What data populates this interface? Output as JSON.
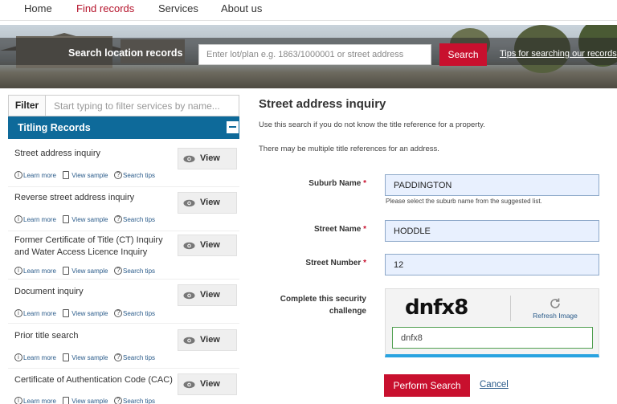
{
  "nav": {
    "items": [
      {
        "label": "Home",
        "active": false
      },
      {
        "label": "Find records",
        "active": true
      },
      {
        "label": "Services",
        "active": false
      },
      {
        "label": "About us",
        "active": false
      }
    ]
  },
  "banner": {
    "search_label": "Search location records",
    "search_placeholder": "Enter lot/plan e.g. 1863/1000001 or street address",
    "search_button": "Search",
    "tips_link": "Tips for searching our records"
  },
  "sidebar": {
    "filter_label": "Filter",
    "filter_placeholder": "Start typing to filter services by name...",
    "group_title": "Titling Records",
    "view_label": "View",
    "links": {
      "learn_more": "Learn more",
      "view_sample": "View sample",
      "search_tips": "Search tips"
    },
    "services": [
      {
        "title": "Street address inquiry"
      },
      {
        "title": "Reverse street address inquiry"
      },
      {
        "title": "Former Certificate of Title (CT) Inquiry and Water Access Licence Inquiry"
      },
      {
        "title": "Document inquiry"
      },
      {
        "title": "Prior title search"
      },
      {
        "title": "Certificate of Authentication Code (CAC)"
      }
    ]
  },
  "main": {
    "title": "Street address inquiry",
    "intro_1": "Use this search if you do not know the title reference for a property.",
    "intro_2": "There may be multiple title references for an address.",
    "required_marker": "*",
    "suburb": {
      "label": "Suburb Name",
      "value": "PADDINGTON",
      "hint": "Please select the suburb name from the suggested list."
    },
    "street": {
      "label": "Street Name",
      "value": "HODDLE"
    },
    "number": {
      "label": "Street Number",
      "value": "12"
    },
    "captcha": {
      "label_line1": "Complete this security",
      "label_line2": "challenge",
      "image_text": "dnfx8",
      "refresh_label": "Refresh Image",
      "input_value": "dnfx8"
    },
    "perform_button": "Perform Search",
    "cancel_link": "Cancel"
  },
  "colors": {
    "brand_red": "#c8102e",
    "header_blue": "#0e6a9a",
    "link_blue": "#2a5b8a",
    "field_bg": "#e8f0fe"
  }
}
